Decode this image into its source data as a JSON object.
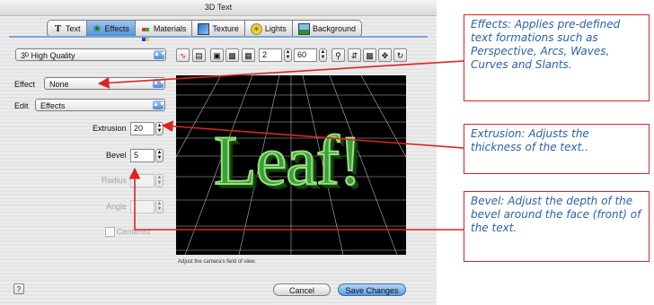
{
  "window": {
    "title": "3D Text"
  },
  "tabs": [
    {
      "label": "Text",
      "icon": "T"
    },
    {
      "label": "Effects",
      "icon": "effects-icon"
    },
    {
      "label": "Materials",
      "icon": "materials-icon"
    },
    {
      "label": "Texture",
      "icon": "texture-icon"
    },
    {
      "label": "Lights",
      "icon": "lights-icon"
    },
    {
      "label": "Background",
      "icon": "background-icon"
    }
  ],
  "active_tab": "Effects",
  "toolbar": {
    "quality": "3ᴰ High Quality",
    "field_value_1": "2",
    "field_value_2": "60"
  },
  "effect": {
    "label": "Effect",
    "value": "None"
  },
  "edit": {
    "label": "Edit",
    "value": "Effects"
  },
  "params": {
    "extrusion_label": "Extrusion",
    "extrusion_value": "20",
    "bevel_label": "Bevel",
    "bevel_value": "5",
    "radius_label": "Radius",
    "angle_label": "Angle",
    "centered_label": "Centered"
  },
  "viewport": {
    "text": "Leaf!",
    "caption": "Adjust the camera's field of view."
  },
  "buttons": {
    "cancel": "Cancel",
    "save": "Save Changes"
  },
  "callouts": {
    "effects": "Effects:  Applies pre-defined text formations such as Perspective, Arcs, Waves, Curves and Slants.",
    "extrusion": "Extrusion: Adjusts the thickness of the text..",
    "bevel": "Bevel: Adjust the depth of the bevel around the face (front) of the text."
  },
  "colors": {
    "accent": "#4f8fd6",
    "callout_border": "#dd2222",
    "callout_text": "#2a5fae",
    "leaf_green": "#2a8a2a"
  }
}
